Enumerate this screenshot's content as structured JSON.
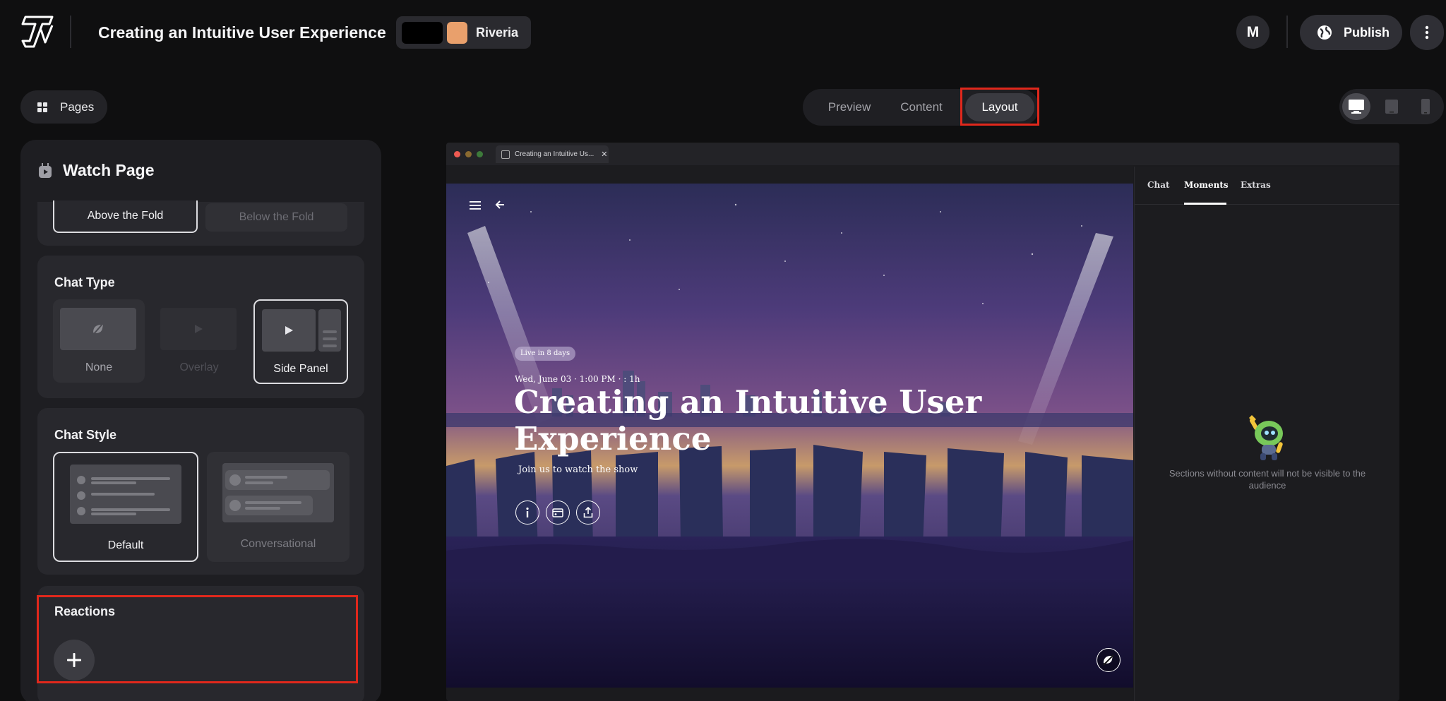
{
  "header": {
    "event_title": "Creating an Intuitive User Experience",
    "theme_name": "Riveria",
    "theme_colors": [
      "#000000",
      "#e9a06c"
    ],
    "avatar_initial": "M",
    "publish_label": "Publish"
  },
  "subnav": {
    "pages_label": "Pages",
    "tabs": [
      {
        "label": "Preview"
      },
      {
        "label": "Content"
      },
      {
        "label": "Layout"
      }
    ],
    "active_tab": "Layout",
    "devices": [
      "desktop-icon",
      "tablet-icon",
      "mobile-icon"
    ],
    "active_device": "desktop"
  },
  "left_panel": {
    "title": "Watch Page",
    "fold": {
      "options": [
        "Above the Fold",
        "Below the Fold"
      ],
      "selected": "Above the Fold"
    },
    "chat_type": {
      "title": "Chat Type",
      "options": [
        "None",
        "Overlay",
        "Side Panel"
      ],
      "selected": "Side Panel"
    },
    "chat_style": {
      "title": "Chat Style",
      "options": [
        "Default",
        "Conversational"
      ],
      "selected": "Default"
    },
    "reactions": {
      "title": "Reactions"
    }
  },
  "preview": {
    "browser_tab_title": "Creating an Intuitive Us...",
    "live_badge": "Live in 8 days",
    "date_line": "Wed, June 03 · 1:00 PM ·    : 1h",
    "hero_title": "Creating an Intuitive User Experience",
    "hero_subtitle": "Join us to watch the show",
    "side_tabs": [
      "Chat",
      "Moments",
      "Extras"
    ],
    "active_side_tab": "Moments",
    "empty_message": "Sections without content will not be visible to the audience"
  },
  "colors": {
    "accent_highlight": "#e0281c",
    "background": "#0f0f10",
    "panel": "#1e1e22"
  }
}
